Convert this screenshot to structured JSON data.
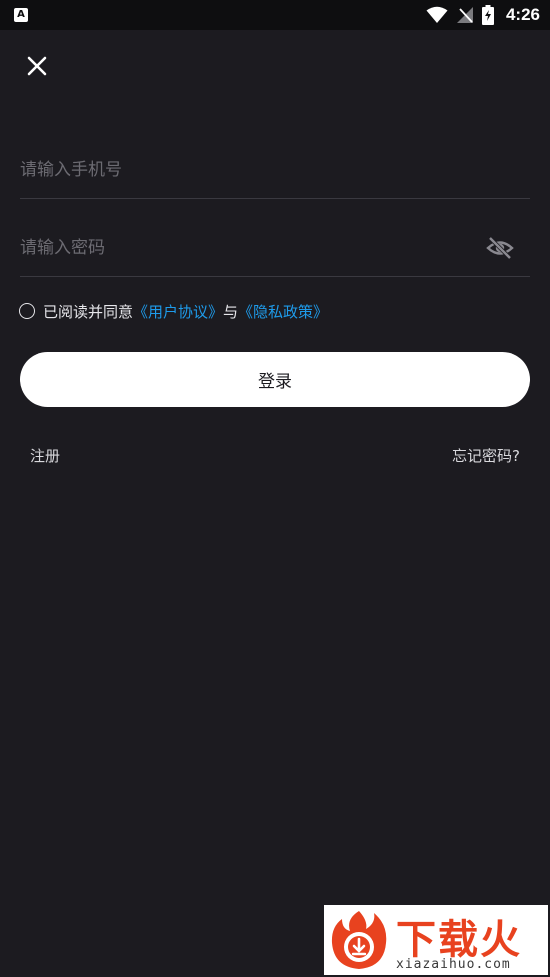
{
  "status_bar": {
    "notification_icon_letter": "A",
    "time": "4:26"
  },
  "login": {
    "phone_placeholder": "请输入手机号",
    "password_placeholder": "请输入密码",
    "agree_prefix": "已阅读并同意",
    "user_agreement": "《用户协议》",
    "agree_and": "与",
    "privacy_policy": "《隐私政策》",
    "login_label": "登录",
    "register_label": "注册",
    "forgot_label": "忘记密码?"
  },
  "watermark": {
    "title": "下载火",
    "subtitle": "xiazaihuo.com"
  },
  "colors": {
    "background": "#1c1b20",
    "link": "#1e9bea",
    "watermark_accent": "#e8421f"
  },
  "icons": {
    "close": "close-icon",
    "password_visibility": "eye-off-icon",
    "wifi": "wifi-icon",
    "signal": "no-signal-icon",
    "battery": "battery-charging-icon"
  }
}
